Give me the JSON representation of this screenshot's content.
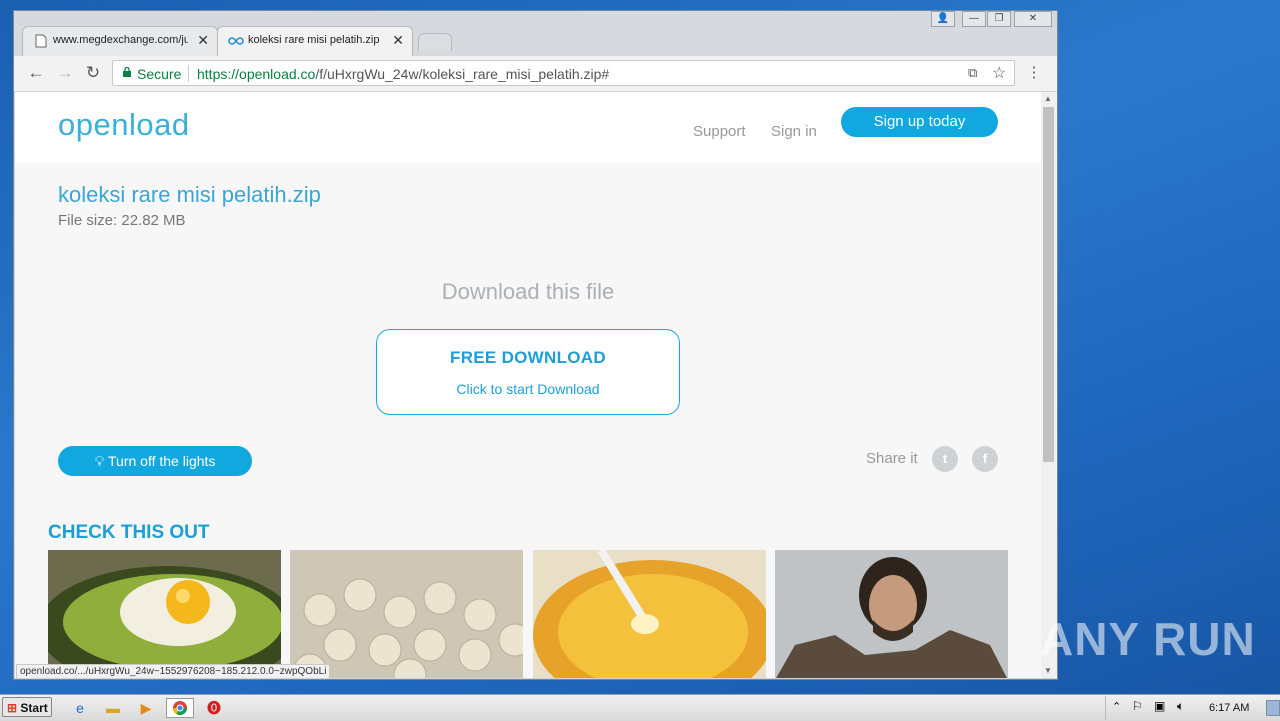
{
  "tabs": [
    {
      "title": "www.megdexchange.com/ju",
      "close": "✕"
    },
    {
      "title": "koleksi rare misi pelatih.zip |",
      "close": "✕"
    }
  ],
  "window_controls": {
    "minimize": "—",
    "restore": "❐",
    "close": "✕"
  },
  "toolbar": {
    "secure_label": "Secure",
    "url_scheme": "https://",
    "url_host": "openload.co",
    "url_path": "/f/uHxrgWu_24w/koleksi_rare_misi_pelatih.zip#"
  },
  "site": {
    "logo": "openload",
    "nav": {
      "support": "Support",
      "signin": "Sign in",
      "signup": "Sign up today"
    },
    "file_name": "koleksi rare misi pelatih.zip",
    "file_size": "File size: 22.82 MB",
    "download_title": "Download this file",
    "download_button": {
      "main": "FREE DOWNLOAD",
      "sub": "Click to start Download"
    },
    "lights_button": "Turn off the lights",
    "share_label": "Share it",
    "social": [
      "twitter-icon",
      "facebook-icon"
    ],
    "check_heading": "CHECK THIS OUT",
    "thumbnails": [
      "avocado-egg",
      "chickpeas",
      "honey-spoon",
      "jon-snow"
    ]
  },
  "status_url": "openload.co/.../uHxrgWu_24w~1552976208~185.212.0.0~zwpQObLi",
  "taskbar": {
    "start": "Start",
    "clock": "6:17 AM"
  },
  "watermark": "ANY RUN",
  "colors": {
    "accent": "#11a8e0",
    "logo": "#3ab0d6"
  }
}
